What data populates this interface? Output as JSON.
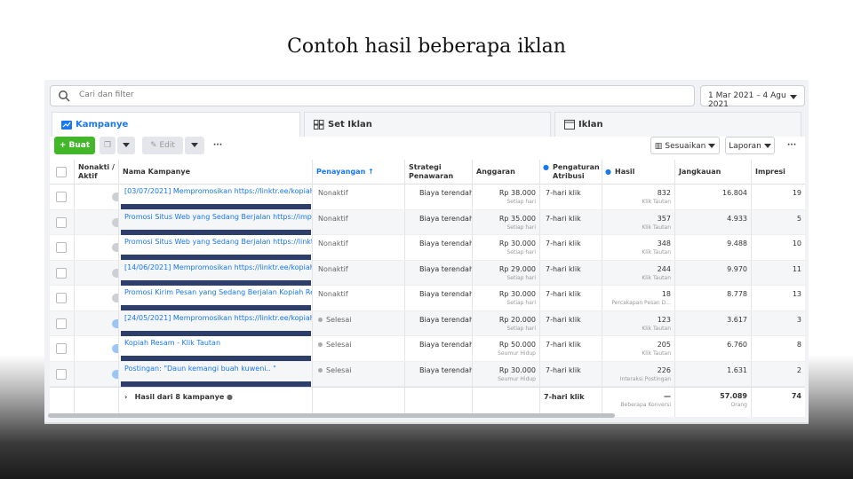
{
  "slide_title": "Contoh hasil beberapa iklan",
  "search": {
    "placeholder": "Cari dan filter"
  },
  "date_range": "1 Mar 2021 – 4 Agu 2021",
  "tabs": [
    {
      "label": "Kampanye",
      "active": true
    },
    {
      "label": "Set Iklan",
      "active": false
    },
    {
      "label": "Iklan",
      "active": false
    }
  ],
  "toolbar": {
    "create": "Buat",
    "edit": "Edit",
    "more": "···",
    "customize": "Sesuaikan",
    "report": "Laporan",
    "more_right": "···"
  },
  "columns": {
    "toggle": "Nonakti / Aktif",
    "name": "Nama Kampanye",
    "delivery": "Penayangan ↑",
    "bid": "Strategi Penawaran",
    "budget": "Anggaran",
    "attribution": "Pengaturan Atribusi",
    "results": "Hasil",
    "reach": "Jangkauan",
    "impressions": "Impresi"
  },
  "rows": [
    {
      "active": false,
      "name": "[03/07/2021] Mempromosikan https://linktr.ee/kopiahr...",
      "delivery": "Nonaktif",
      "bid": "Biaya terendah",
      "budget": "Rp 38.000",
      "budget_sub": "Setiap hari",
      "attribution": "7-hari klik",
      "results": "832",
      "results_sub": "Klik Tautan",
      "reach": "16.804",
      "impressions": "19"
    },
    {
      "active": false,
      "name": "Promosi Situs Web yang Sedang Berjalan https://impia...",
      "delivery": "Nonaktif",
      "bid": "Biaya terendah",
      "budget": "Rp 35.000",
      "budget_sub": "Setiap hari",
      "attribution": "7-hari klik",
      "results": "357",
      "results_sub": "Klik Tautan",
      "reach": "4.933",
      "impressions": "5"
    },
    {
      "active": false,
      "name": "Promosi Situs Web yang Sedang Berjalan https://linktr...",
      "delivery": "Nonaktif",
      "bid": "Biaya terendah",
      "budget": "Rp 30.000",
      "budget_sub": "Setiap hari",
      "attribution": "7-hari klik",
      "results": "348",
      "results_sub": "Klik Tautan",
      "reach": "9.488",
      "impressions": "10"
    },
    {
      "active": false,
      "name": "[14/06/2021] Mempromosikan https://linktr.ee/kopiahr...",
      "delivery": "Nonaktif",
      "bid": "Biaya terendah",
      "budget": "Rp 29.000",
      "budget_sub": "Setiap hari",
      "attribution": "7-hari klik",
      "results": "244",
      "results_sub": "Klik Tautan",
      "reach": "9.970",
      "impressions": "11"
    },
    {
      "active": false,
      "name": "Promosi Kirim Pesan yang Sedang Berjalan Kopiah Res...",
      "delivery": "Nonaktif",
      "bid": "Biaya terendah",
      "budget": "Rp 30.000",
      "budget_sub": "Setiap hari",
      "attribution": "7-hari klik",
      "results": "18",
      "results_sub": "Percakapan Pesan D...",
      "reach": "8.778",
      "impressions": "13"
    },
    {
      "active": true,
      "name": "[24/05/2021] Mempromosikan https://linktr.ee/kopiahr...",
      "delivery": "Selesai",
      "bid": "Biaya terendah",
      "budget": "Rp 20.000",
      "budget_sub": "Setiap hari",
      "attribution": "7-hari klik",
      "results": "123",
      "results_sub": "Klik Tautan",
      "reach": "3.617",
      "impressions": "3"
    },
    {
      "active": true,
      "name": "Kopiah Resam - Klik Tautan",
      "delivery": "Selesai",
      "bid": "Biaya terendah",
      "budget": "Rp 50.000",
      "budget_sub": "Seumur Hidup",
      "attribution": "7-hari klik",
      "results": "205",
      "results_sub": "Klik Tautan",
      "reach": "6.760",
      "impressions": "8"
    },
    {
      "active": true,
      "name": "Postingan: \"Daun kemangi buah kuweni.. \"",
      "delivery": "Selesai",
      "bid": "Biaya terendah",
      "budget": "Rp 30.000",
      "budget_sub": "Seumur Hidup",
      "attribution": "7-hari klik",
      "results": "226",
      "results_sub": "Interaksi Postingan",
      "reach": "1.631",
      "impressions": "2"
    }
  ],
  "totals": {
    "label": "Hasil dari 8 kampanye",
    "attribution": "7-hari klik",
    "results": "—",
    "results_sub": "Beberapa Konversi",
    "reach": "57.089",
    "reach_sub": "Orang",
    "impressions": "74"
  },
  "colors": {
    "accent": "#1877f2",
    "create": "#42b72a",
    "redaction": "#2d3e6b"
  }
}
